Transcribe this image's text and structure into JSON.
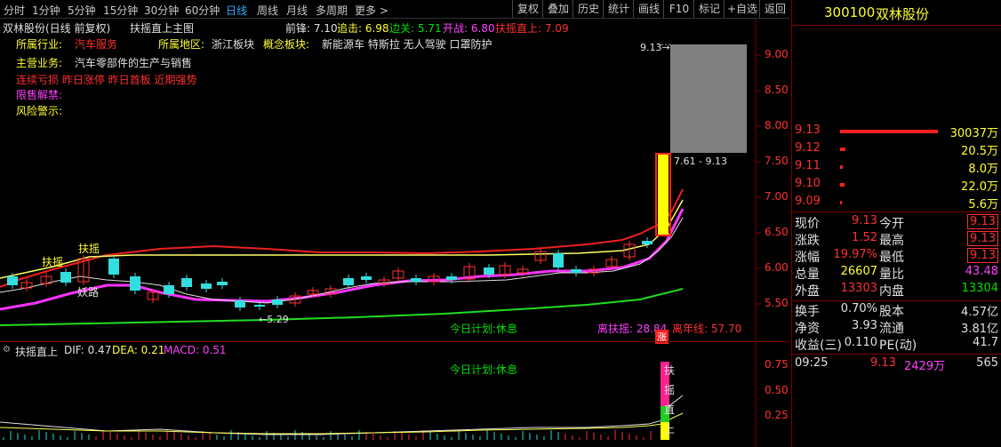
{
  "toolbar": {
    "periods": [
      "分时",
      "1分钟",
      "5分钟",
      "15分钟",
      "30分钟",
      "60分钟",
      "日线",
      "周线",
      "月线",
      "多周期",
      "更多 >"
    ],
    "active_period": "日线",
    "right_buttons": [
      "复权",
      "叠加",
      "历史",
      "统计",
      "画线",
      "F10",
      "标记",
      "+自选",
      "返回"
    ]
  },
  "header": {
    "title": "双林股份(日线 前复权)",
    "indicator_name": "扶摇直上主图",
    "labels": {
      "qianfeng": "前锋: 7.10",
      "zhuiji": "追击: 6.98",
      "bianguan": "边关: 5.71",
      "kaizhan": "开战: 6.80",
      "fuyao": "扶摇直上: 7.09"
    }
  },
  "info": {
    "industry_label": "所属行业:",
    "industry": "汽车服务",
    "region_label": "所属地区:",
    "region": "浙江板块",
    "concept_label": "概念板块:",
    "concepts": "新能源车 特斯拉 无人驾驶 口罩防护",
    "business_label": "主营业务:",
    "business": "汽车零部件的生产与销售",
    "tags": "连续亏损 昨日涨停 昨日首板 近期强势",
    "unlock_label": "限售解禁:",
    "risk_label": "风险警示:"
  },
  "chart_labels": {
    "fuyao1": "扶摇",
    "fuyao2": "扶摇",
    "yaolu": "妖路",
    "low_mark": "5.29",
    "high_mark": "9.13",
    "range_mark": "7.61 - 9.13",
    "plan": "今日计划:休息",
    "li_fuyao": "离扶摇: 28.84",
    "li_nianxian": "离年线: 57.70",
    "zhang": "涨"
  },
  "price_axis": [
    "9.00",
    "8.50",
    "8.00",
    "7.50",
    "7.00",
    "6.50",
    "6.00",
    "5.50"
  ],
  "macd": {
    "title": "扶摇直上",
    "dif": "DIF: 0.47",
    "dea": "DEA: 0.21",
    "macd": "MACD: 0.51",
    "plan": "今日计划:休息",
    "axis": [
      "0.75",
      "0.50",
      "0.25"
    ],
    "vertical_text": [
      "扶",
      "摇",
      "直",
      "上"
    ]
  },
  "quote": {
    "code": "300100",
    "name": "双林股份",
    "orderbook": [
      {
        "price": "9.13",
        "vol": "30037万"
      },
      {
        "price": "9.12",
        "vol": "20.5万"
      },
      {
        "price": "9.11",
        "vol": "8.0万"
      },
      {
        "price": "9.10",
        "vol": "22.0万"
      },
      {
        "price": "9.09",
        "vol": "5.6万"
      }
    ],
    "stats": [
      {
        "l1": "现价",
        "v1": "9.13",
        "l2": "今开",
        "v2": "9.13"
      },
      {
        "l1": "涨跌",
        "v1": "1.52",
        "l2": "最高",
        "v2": "9.13"
      },
      {
        "l1": "涨幅",
        "v1": "19.97%",
        "l2": "最低",
        "v2": "9.13"
      },
      {
        "l1": "总量",
        "v1": "26607",
        "l2": "量比",
        "v2": "43.48"
      },
      {
        "l1": "外盘",
        "v1": "13303",
        "l2": "内盘",
        "v2": "13304"
      }
    ],
    "fundamentals": [
      {
        "l1": "换手",
        "v1": "0.70%",
        "l2": "股本",
        "v2": "4.57亿"
      },
      {
        "l1": "净资",
        "v1": "3.93",
        "l2": "流通",
        "v2": "3.81亿"
      },
      {
        "l1": "收益(三)",
        "v1": "0.110",
        "l2": "PE(动)",
        "v2": "41.7"
      }
    ],
    "tick": {
      "time": "09:25",
      "price": "9.13",
      "vol": "2429万",
      "count": "565"
    }
  },
  "colors": {
    "up": "#ff3030",
    "down": "#33dddd",
    "ma_yellow": "#ffff66",
    "ma_magenta": "#ff33ff",
    "ma_red": "#ee2020",
    "ma_green": "#22dd22"
  }
}
